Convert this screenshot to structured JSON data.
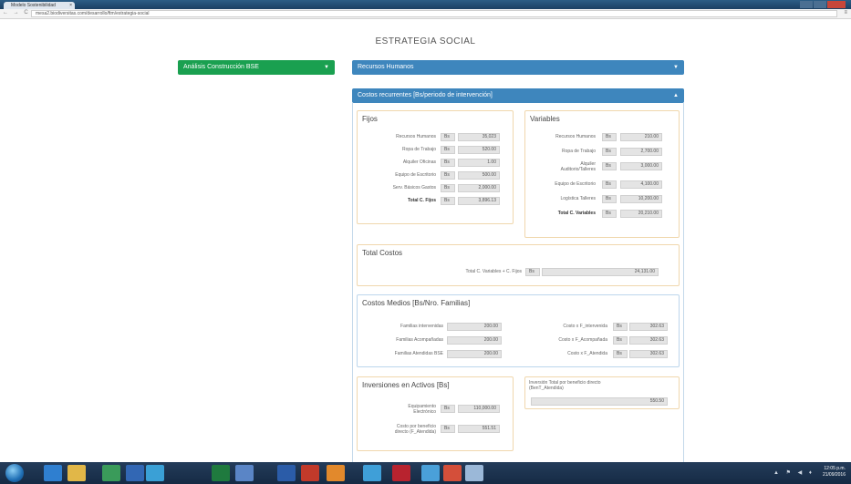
{
  "browser": {
    "tab_title": "Modelo Sostenibilidad",
    "tab_close": "×",
    "url": "mesa2.biodiversitas.com/desarrollo/ftm/estrategia-social",
    "nav_glyphs": "← → C",
    "menu_glyph": "≡"
  },
  "page": {
    "title": "ESTRATEGIA SOCIAL"
  },
  "analysis_dropdown": {
    "label": "Análisis Construcción BSE",
    "caret": "▼"
  },
  "rrhh_section": {
    "label": "Recursos Humanos",
    "caret": "▼"
  },
  "costos_section": {
    "label": "Costos recurrentes [Bs/periodo de intervención]",
    "caret": "▲"
  },
  "fijos": {
    "title": "Fijos",
    "rows": [
      {
        "label": "Recursos Humanos",
        "currency": "Bs",
        "value": "35,023"
      },
      {
        "label": "Ropa de Trabajo",
        "currency": "Bs",
        "value": "520.00"
      },
      {
        "label": "Alquiler Oficinas",
        "currency": "Bs",
        "value": "1.00"
      },
      {
        "label": "Equipo de Escritorio",
        "currency": "Bs",
        "value": "500.00"
      },
      {
        "label": "Serv. Básicos Gastos",
        "currency": "Bs",
        "value": "2,000.00"
      },
      {
        "label": "Total C. Fijos",
        "currency": "Bs",
        "value": "3,896.13"
      }
    ]
  },
  "variables": {
    "title": "Variables",
    "rows": [
      {
        "label": "Recursos Humanos",
        "currency": "Bs",
        "value": "210.00"
      },
      {
        "label": "Ropa de Trabajo",
        "currency": "Bs",
        "value": "2,700.00"
      },
      {
        "label": "Alquiler Auditorio/Talleres",
        "currency": "Bs",
        "value": "3,000.00"
      },
      {
        "label": "Equipo de Escritorio",
        "currency": "Bs",
        "value": "4,100.00"
      },
      {
        "label": "Logística Talleres",
        "currency": "Bs",
        "value": "10,200.00"
      },
      {
        "label": "Total C. Variables",
        "currency": "Bs",
        "value": "20,210.00"
      }
    ]
  },
  "total_costos": {
    "title": "Total Costos",
    "label": "Total C. Variables + C. Fijos",
    "currency": "Bs",
    "value": "24,131.00"
  },
  "costos_medios": {
    "title": "Costos Medios [Bs/Nro. Familias]",
    "left_rows": [
      {
        "label": "Familias intervenidas",
        "value": "200.00"
      },
      {
        "label": "Familias Acompañadas",
        "value": "200.00"
      },
      {
        "label": "Familias Atendidas BSE",
        "value": "200.00"
      }
    ],
    "right_rows": [
      {
        "label": "Costo x F_intervenida",
        "currency": "Bs",
        "value": "302.63"
      },
      {
        "label": "Costo x F_Acompañada",
        "currency": "Bs",
        "value": "302.63"
      },
      {
        "label": "Costo x F_Atendida",
        "currency": "Bs",
        "value": "302.63"
      }
    ]
  },
  "inversiones": {
    "title": "Inversiones en Activos [Bs]",
    "rows": [
      {
        "label": "Equipamiento Electrónico",
        "currency": "Bs",
        "value": "110,000.00"
      },
      {
        "label": "Costo por beneficio directo (F_Atendida)",
        "currency": "Bs",
        "value": "551.51"
      }
    ]
  },
  "inversion_total": {
    "label": "Inversión Total por beneficio directo (BenT_Atendida)",
    "value": "550.50"
  },
  "taskbar": {
    "tray_glyphs": "▲ ⚑ ◀ ♦",
    "clock_time": "12:05 p.m.",
    "clock_date": "21/09/2016"
  },
  "colors": {
    "green_accent": "#1aa050",
    "blue_accent": "#3e86bd",
    "orange_border": "#f0d7ad"
  }
}
